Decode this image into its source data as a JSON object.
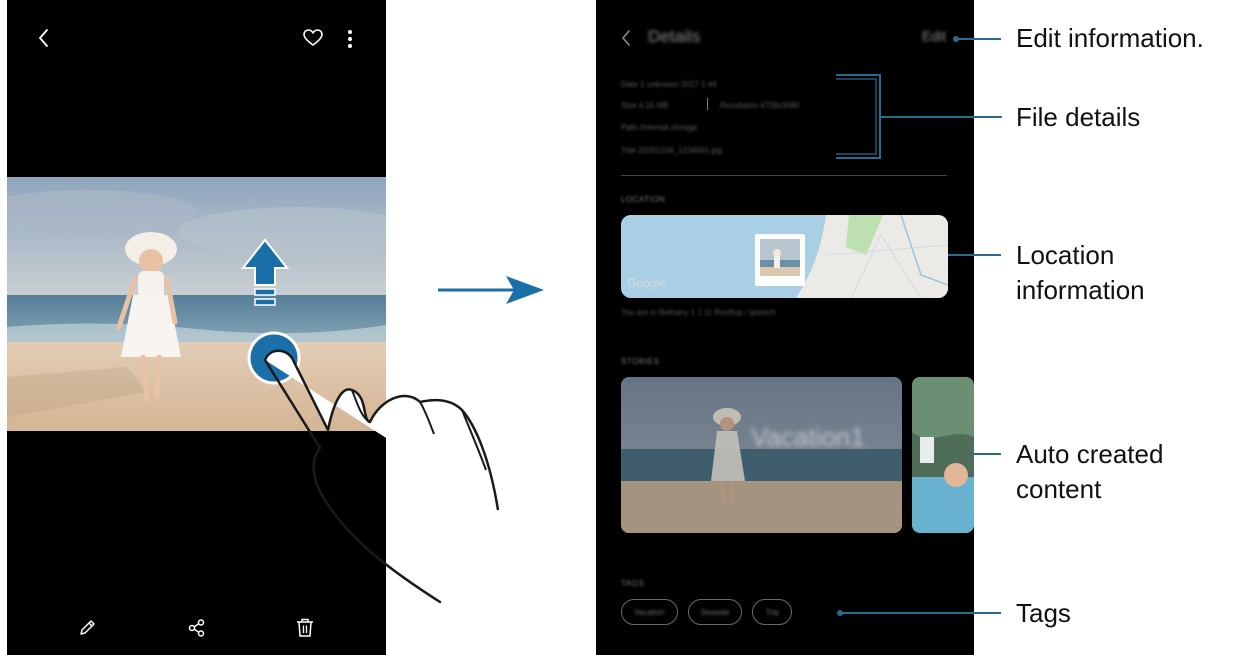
{
  "left_screen": {
    "toolbar_icons": [
      "back-icon",
      "heart-icon",
      "more-options-icon"
    ],
    "bottom_icons": [
      "edit-pencil-icon",
      "share-icon",
      "delete-trash-icon"
    ],
    "gesture": "swipe-up"
  },
  "right_screen": {
    "header": {
      "title": "Details",
      "edit_label": "Edit"
    },
    "info": {
      "date": "Date   1 unknown 2017 1:44",
      "size": "Size   4.15 MB",
      "resolution": "Resolution   4728x3080",
      "path": "Path   /Internal storage",
      "title": "Title   20201234_1234561.jpg"
    },
    "location": {
      "section_label": "LOCATION",
      "map_brand": "Google",
      "address": "You are in Bethany   1 1 11 Rooftop / Ipswich"
    },
    "stories": {
      "section_label": "STORIES",
      "story_title": "Vacation1"
    },
    "tags": {
      "section_label": "TAGS",
      "items": [
        "Vacation",
        "Seaside",
        "Trip"
      ]
    }
  },
  "callouts": {
    "edit_information": "Edit information.",
    "file_details": "File details",
    "location_line1": "Location",
    "location_line2": "information",
    "auto_line1": "Auto created",
    "auto_line2": "content",
    "tags": "Tags"
  },
  "colors": {
    "accent": "#1b6fa8",
    "callout_line": "#2b6a8f",
    "screen_bg": "#000000"
  }
}
